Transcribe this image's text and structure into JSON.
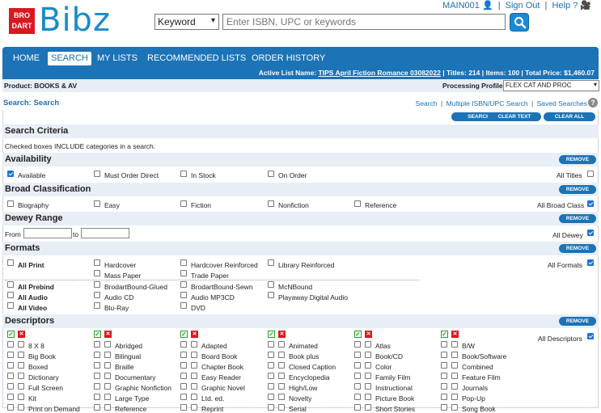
{
  "logo": {
    "badge_line1": "BRO",
    "badge_line2": "DART",
    "name": "Bibz"
  },
  "search": {
    "type_value": "Keyword",
    "placeholder": "Enter ISBN, UPC or keywords"
  },
  "account": {
    "user": "MAIN001",
    "sign_out": "Sign Out",
    "help": "Help ?"
  },
  "nav": {
    "items": [
      "HOME",
      "SEARCH",
      "MY LISTS",
      "RECOMMENDED LISTS",
      "ORDER HISTORY"
    ],
    "active": "SEARCH"
  },
  "active_list": {
    "label": "Active List Name:",
    "name": "TIPS April Fiction Romance 03082022",
    "summary": "| Titles: 214 | Items: 100 | Total Price: $1,460.07"
  },
  "product": {
    "label": "Product: BOOKS & AV",
    "processing_label": "Processing Profile:",
    "processing_value": "FLEX CAT AND PROC"
  },
  "search_header": {
    "title": "Search: Search",
    "links": [
      "Search",
      "Multiple ISBN/UPC Search",
      "Saved Searches"
    ],
    "help_icon": "?"
  },
  "action_buttons": [
    "SEARCH",
    "CLEAR TEXT",
    "CLEAR ALL"
  ],
  "criteria": {
    "title": "Search Criteria",
    "note": "Checked boxes INCLUDE categories in a search.",
    "remove_label": "REMOVE"
  },
  "availability": {
    "title": "Availability",
    "options": [
      {
        "label": "Available",
        "checked": true
      },
      {
        "label": "Must Order Direct",
        "checked": false
      },
      {
        "label": "In Stock",
        "checked": false
      },
      {
        "label": "On Order",
        "checked": false
      }
    ],
    "all_label": "All Titles",
    "all_checked": false
  },
  "broad": {
    "title": "Broad Classification",
    "options": [
      "Biography",
      "Easy",
      "Fiction",
      "Nonfiction",
      "Reference"
    ],
    "all_label": "All Broad Class",
    "all_checked": true
  },
  "dewey": {
    "title": "Dewey Range",
    "from_label": "From",
    "to_label": "to",
    "all_label": "All Dewey",
    "all_checked": true
  },
  "formats": {
    "title": "Formats",
    "row1": [
      "All Print",
      "Hardcover",
      "Hardcover Reinforced",
      "Library Reinforced"
    ],
    "row1b": [
      "Mass Paper",
      "Trade Paper"
    ],
    "row2": [
      "All Prebind",
      "BrodartBound-Glued",
      "BrodartBound-Sewn",
      "McNBound"
    ],
    "row3": [
      "All Audio",
      "Audio CD",
      "Audio MP3CD",
      "Playaway Digital Audio"
    ],
    "row4": [
      "All Video",
      "Blu-Ray",
      "DVD"
    ],
    "all_label": "All Formats",
    "all_checked": true
  },
  "descriptors": {
    "title": "Descriptors",
    "all_label": "All Descriptors",
    "all_checked": true,
    "columns": [
      [
        "8 X 8",
        "Big Book",
        "Boxed",
        "Dictionary",
        "Full Screen",
        "Kit",
        "Print on Demand"
      ],
      [
        "Abridged",
        "Bilingual",
        "Braille",
        "Documentary",
        "Graphic Nonfiction",
        "Large Type",
        "Reference"
      ],
      [
        "Adapted",
        "Board Book",
        "Chapter Book",
        "Easy Reader",
        "Graphic Novel",
        "Ltd. ed.",
        "Reprint"
      ],
      [
        "Animated",
        "Book plus",
        "Closed Caption",
        "Encyclopedia",
        "High/Low",
        "Novelty",
        "Serial"
      ],
      [
        "Atlas",
        "Book/CD",
        "Color",
        "Family Film",
        "Instructional",
        "Picture Book",
        "Short Stories"
      ],
      [
        "B/W",
        "Book/Software",
        "Combined",
        "Feature Film",
        "Journals",
        "Pop-Up",
        "Song Book"
      ]
    ]
  },
  "colors": {
    "brand_blue": "#1c73b6",
    "logo_red": "#d71920",
    "band_bg": "#e7eef6",
    "link_blue": "#1b6fb5"
  }
}
